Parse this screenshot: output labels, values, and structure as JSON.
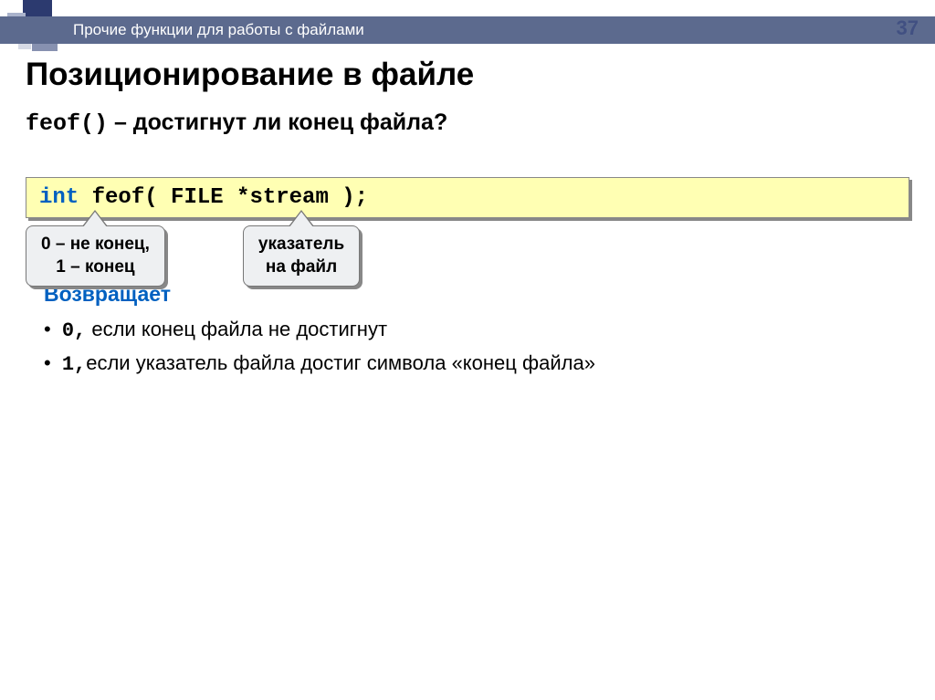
{
  "page_number": "37",
  "header": "Прочие функции для работы с файлами",
  "title": "Позиционирование в файле",
  "subtitle_func": "feof()",
  "subtitle_text": " – достигнут ли конец файла?",
  "code": {
    "kw": "int",
    "rest": " feof( FILE *stream );"
  },
  "callouts": [
    "0 – не конец,\n1 – конец",
    "указатель\nна файл"
  ],
  "returns_title": "Возвращает",
  "returns": [
    {
      "code": "0,",
      "text": " если конец файла не достигнут"
    },
    {
      "code": "1,",
      "text": "если указатель файла достиг символа «конец файла»"
    }
  ]
}
